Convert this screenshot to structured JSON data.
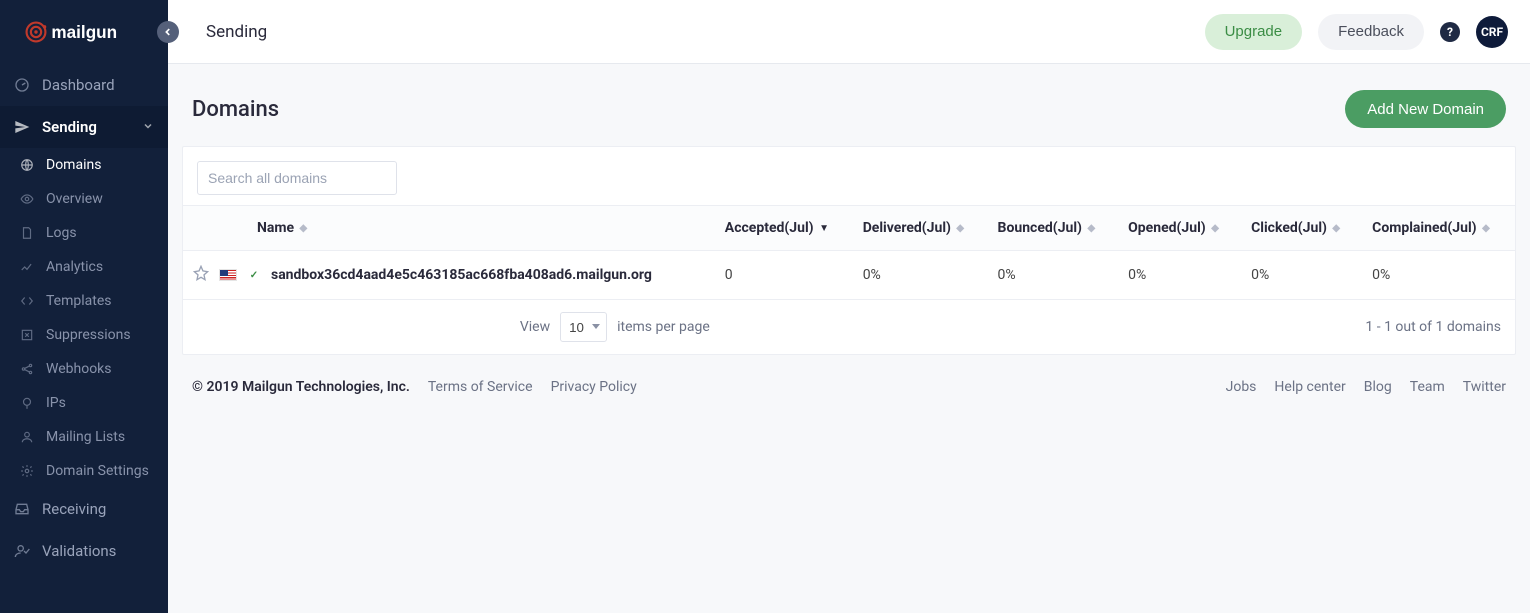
{
  "brand": "mailgun",
  "sidebar": {
    "top": [
      {
        "label": "Dashboard",
        "icon": "gauge"
      }
    ],
    "sending": {
      "label": "Sending",
      "items": [
        {
          "label": "Domains",
          "icon": "globe",
          "active": true
        },
        {
          "label": "Overview",
          "icon": "eye"
        },
        {
          "label": "Logs",
          "icon": "file"
        },
        {
          "label": "Analytics",
          "icon": "chart"
        },
        {
          "label": "Templates",
          "icon": "code"
        },
        {
          "label": "Suppressions",
          "icon": "x-square"
        },
        {
          "label": "Webhooks",
          "icon": "share"
        },
        {
          "label": "IPs",
          "icon": "pin"
        },
        {
          "label": "Mailing Lists",
          "icon": "user"
        },
        {
          "label": "Domain Settings",
          "icon": "gear"
        }
      ]
    },
    "bottom": [
      {
        "label": "Receiving",
        "icon": "inbox"
      },
      {
        "label": "Validations",
        "icon": "user-check"
      }
    ]
  },
  "topbar": {
    "breadcrumb": "Sending",
    "upgrade": "Upgrade",
    "feedback": "Feedback",
    "avatar": "CRF"
  },
  "page": {
    "title": "Domains",
    "add_button": "Add New Domain",
    "search_placeholder": "Search all domains"
  },
  "table": {
    "columns": {
      "name": "Name",
      "accepted": "Accepted(Jul)",
      "delivered": "Delivered(Jul)",
      "bounced": "Bounced(Jul)",
      "opened": "Opened(Jul)",
      "clicked": "Clicked(Jul)",
      "complained": "Complained(Jul)"
    },
    "rows": [
      {
        "name": "sandbox36cd4aad4e5c463185ac668fba408ad6.mailgun.org",
        "accepted": "0",
        "delivered": "0%",
        "bounced": "0%",
        "opened": "0%",
        "clicked": "0%",
        "complained": "0%"
      }
    ]
  },
  "pager": {
    "view_label": "View",
    "per_page": "10",
    "items_label": "items per page",
    "count": "1 - 1 out of 1 domains"
  },
  "footer": {
    "copyright": "© 2019 Mailgun Technologies, Inc.",
    "left_links": [
      "Terms of Service",
      "Privacy Policy"
    ],
    "right_links": [
      "Jobs",
      "Help center",
      "Blog",
      "Team",
      "Twitter"
    ]
  }
}
